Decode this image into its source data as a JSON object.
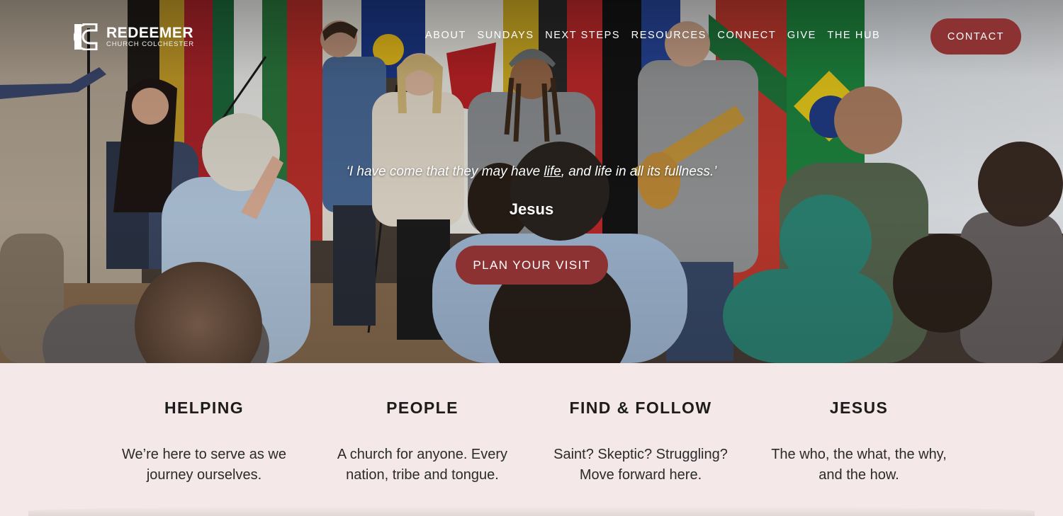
{
  "header": {
    "logo_name": "REDEEMER",
    "logo_sub": "CHURCH COLCHESTER",
    "nav": [
      "ABOUT",
      "SUNDAYS",
      "NEXT STEPS",
      "RESOURCES",
      "CONNECT",
      "GIVE",
      "THE HUB"
    ],
    "contact_label": "CONTACT"
  },
  "hero": {
    "quote_before": "‘I have come that they may have ",
    "quote_underlined": "life",
    "quote_after": ", and life in all its fullness.’",
    "quote_author": "Jesus",
    "cta_label": "PLAN YOUR VISIT"
  },
  "features": [
    {
      "title": "HELPING",
      "line1": "We’re here to serve as we",
      "line2": "journey ourselves."
    },
    {
      "title": "PEOPLE",
      "line1": "A church for anyone. Every",
      "line2": "nation, tribe and tongue."
    },
    {
      "title": "FIND & FOLLOW",
      "line1": "Saint? Skeptic? Struggling?",
      "line2": "Move forward here."
    },
    {
      "title": "JESUS",
      "line1": "The who, the what, the why,",
      "line2": "and the how."
    }
  ],
  "colors": {
    "accent": "#8d3233",
    "features_bg": "#f4e9e8"
  },
  "icons": [
    "redeemer-logo-icon"
  ]
}
